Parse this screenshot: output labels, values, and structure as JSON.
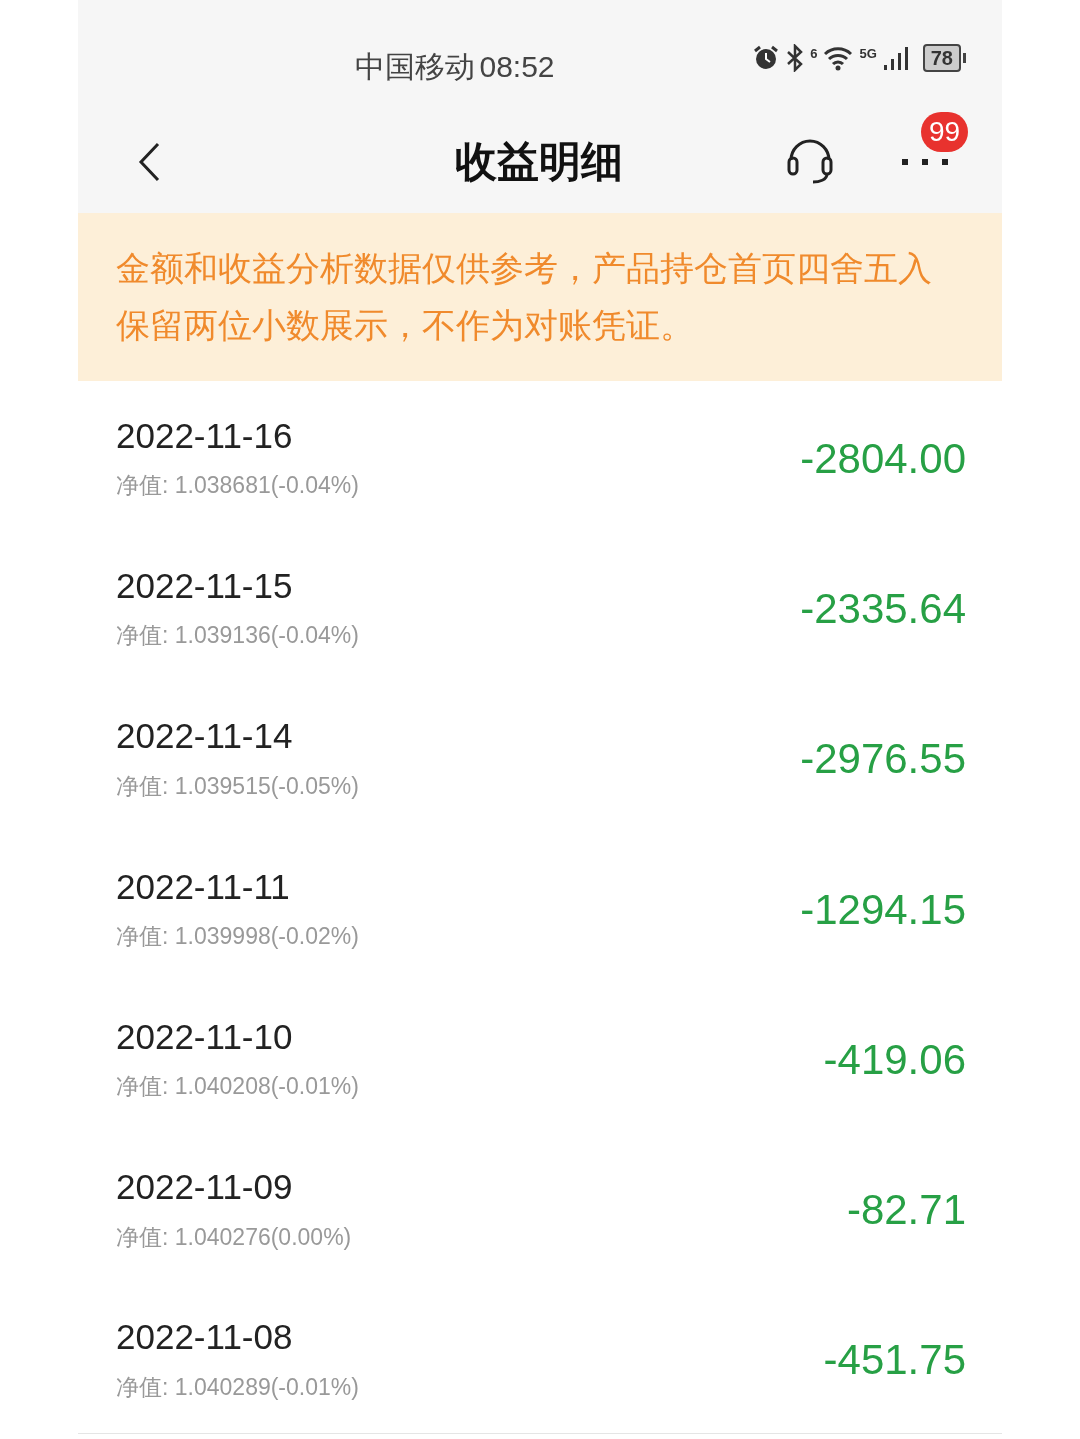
{
  "status_bar": {
    "carrier": "中国移动",
    "time": "08:52",
    "wifi_badge": "6",
    "network": "5G",
    "battery": "78"
  },
  "header": {
    "title": "收益明细",
    "badge": "99"
  },
  "notice": "金额和收益分析数据仅供参考，产品持仓首页四舍五入保留两位小数展示，不作为对账凭证。",
  "rows": [
    {
      "date": "2022-11-16",
      "nav": "净值: 1.038681(-0.04%)",
      "amount": "-2804.00"
    },
    {
      "date": "2022-11-15",
      "nav": "净值: 1.039136(-0.04%)",
      "amount": "-2335.64"
    },
    {
      "date": "2022-11-14",
      "nav": "净值: 1.039515(-0.05%)",
      "amount": "-2976.55"
    },
    {
      "date": "2022-11-11",
      "nav": "净值: 1.039998(-0.02%)",
      "amount": "-1294.15"
    },
    {
      "date": "2022-11-10",
      "nav": "净值: 1.040208(-0.01%)",
      "amount": "-419.06"
    },
    {
      "date": "2022-11-09",
      "nav": "净值: 1.040276(0.00%)",
      "amount": "-82.71"
    },
    {
      "date": "2022-11-08",
      "nav": "净值: 1.040289(-0.01%)",
      "amount": "-451.75"
    }
  ]
}
